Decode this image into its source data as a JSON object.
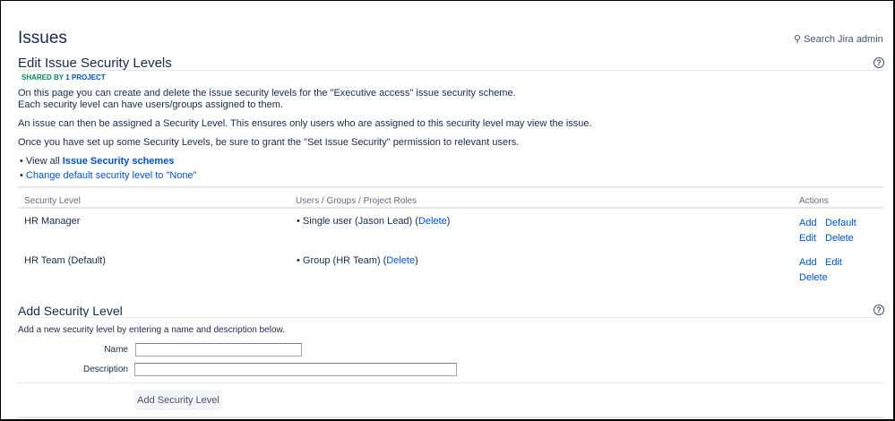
{
  "page_title": "Issues",
  "search_label": "Search Jira admin",
  "section_title": "Edit Issue Security Levels",
  "badge": {
    "prefix": "SHARED BY",
    "count_label": "1 PROJECT"
  },
  "paragraphs": [
    "On this page you can create and delete the issue security levels for the \"Executive access\" issue security scheme.",
    "Each security level can have users/groups assigned to them.",
    "An issue can then be assigned a Security Level. This ensures only users who are assigned to this security level may view the issue.",
    "Once you have set up some Security Levels, be sure to grant the \"Set Issue Security\" permission to relevant users."
  ],
  "links": {
    "view_all_prefix": "View all",
    "view_all_link": "Issue Security schemes",
    "change_default": "Change default security level to \"None\""
  },
  "table": {
    "headers": [
      "Security Level",
      "Users / Groups / Project Roles",
      "Actions"
    ],
    "rows": [
      {
        "level": "HR Manager",
        "member": "Single user (Jason Lead)",
        "member_delete": "Delete",
        "actions": [
          "Add",
          "Default",
          "Edit",
          "Delete"
        ]
      },
      {
        "level": "HR Team (Default)",
        "member": "Group (HR Team)",
        "member_delete": "Delete",
        "actions": [
          "Add",
          "Edit",
          "Delete"
        ]
      }
    ]
  },
  "add_section": {
    "title": "Add Security Level",
    "description": "Add a new security level by entering a name and description below.",
    "name_label": "Name",
    "name_value": "",
    "description_label": "Description",
    "description_value": "",
    "submit_label": "Add Security Level"
  }
}
